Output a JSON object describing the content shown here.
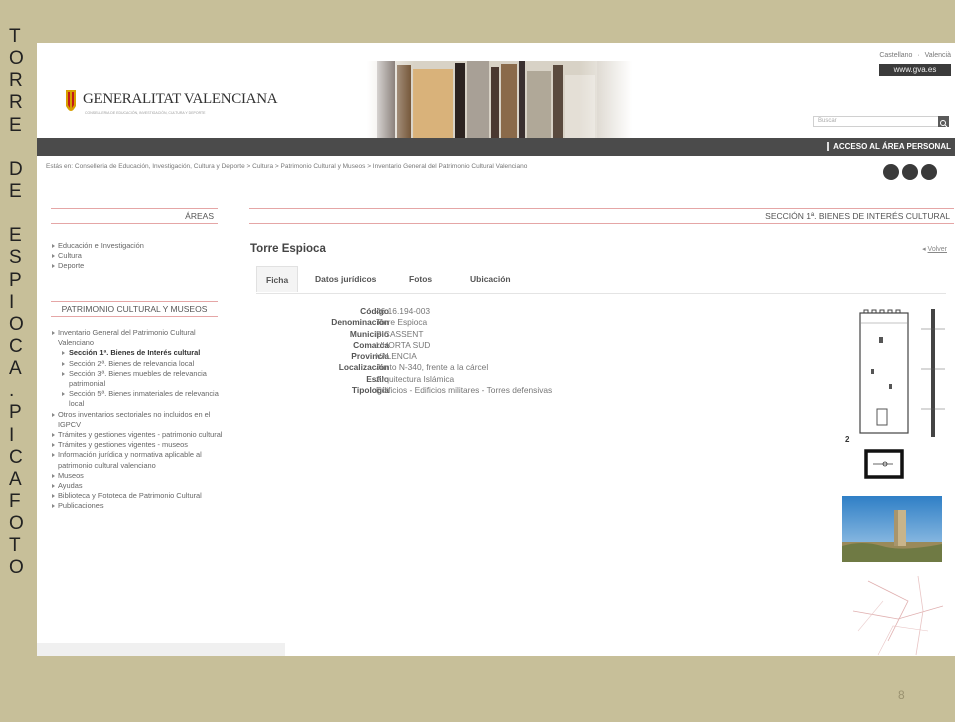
{
  "slide": {
    "vertical_letters": [
      "T",
      "O",
      "R",
      "R",
      "E",
      "",
      "D",
      "E",
      "",
      "E",
      "S",
      "P",
      "I",
      "O",
      "C",
      "A",
      ".",
      "P",
      "I",
      "C",
      "A",
      "F",
      "O",
      "T",
      "O"
    ],
    "page_number": "8"
  },
  "header": {
    "lang_links": "Castellano · Valencià",
    "gva_link": "www.gva.es",
    "logo_name": "GENERALITAT VALENCIANA",
    "logo_sub": "CONSELLERIA DE EDUCACIÓN, INVESTIGACIÓN, CULTURA Y DEPORTE",
    "search_placeholder": "Buscar",
    "personal_area": "ACCESO AL ÁREA PERSONAL"
  },
  "breadcrumb": "Estás en: Conselleria de Educación, Investigación, Cultura y Deporte > Cultura > Patrimonio Cultural y Museos > Inventario General del Patrimonio Cultural Valenciano",
  "sidebar": {
    "areas_title": "ÁREAS",
    "areas": [
      "Educación e Investigación",
      "Cultura",
      "Deporte"
    ],
    "patrimonio_title": "PATRIMONIO CULTURAL Y MUSEOS",
    "patrimonio": [
      {
        "text": "Inventario General del Patrimonio Cultural Valenciano",
        "level": 0
      },
      {
        "text": "Sección 1ª. Bienes de Interés cultural",
        "level": 1,
        "active": true
      },
      {
        "text": "Sección 2ª. Bienes de relevancia local",
        "level": 1
      },
      {
        "text": "Sección 3ª. Bienes muebles de relevancia patrimonial",
        "level": 1
      },
      {
        "text": "Sección 5ª. Bienes inmateriales de relevancia local",
        "level": 1
      },
      {
        "text": "Otros inventarios sectoriales no incluidos en el IGPCV",
        "level": 0
      },
      {
        "text": "Trámites y gestiones vigentes - patrimonio cultural",
        "level": 0
      },
      {
        "text": "Trámites y gestiones vigentes - museos",
        "level": 0
      },
      {
        "text": "Información jurídica y normativa aplicable al patrimonio cultural valenciano",
        "level": 0
      },
      {
        "text": "Museos",
        "level": 0
      },
      {
        "text": "Ayudas",
        "level": 0
      },
      {
        "text": "Biblioteca y Fototeca de Patrimonio Cultural",
        "level": 0
      },
      {
        "text": "Publicaciones",
        "level": 0
      }
    ]
  },
  "main": {
    "section_title": "SECCIÓN 1ª. BIENES DE INTERÉS CULTURAL",
    "title": "Torre Espioca",
    "back": "Volver",
    "tabs": [
      "Ficha",
      "Datos jurídicos",
      "Fotos",
      "Ubicación"
    ],
    "fields": [
      {
        "label": "Código",
        "value": "46.16.194-003"
      },
      {
        "label": "Denominación",
        "value": "Torre Espioca"
      },
      {
        "label": "Municipio",
        "value": "PICASSENT"
      },
      {
        "label": "Comarca",
        "value": "L'HORTA SUD"
      },
      {
        "label": "Provincia",
        "value": "VALENCIA"
      },
      {
        "label": "Localización",
        "value": "Junto N-340, frente a la cárcel"
      },
      {
        "label": "Estilo",
        "value": "Arquitectura Islámica"
      },
      {
        "label": "Tipología",
        "value": "Edificios - Edificios militares - Torres defensivas"
      }
    ],
    "figure_number": "2"
  },
  "colors": {
    "slide_bg": "#c7bf99",
    "dark_bar": "#4b4b4b",
    "accent_rule": "#e5a6a6"
  }
}
